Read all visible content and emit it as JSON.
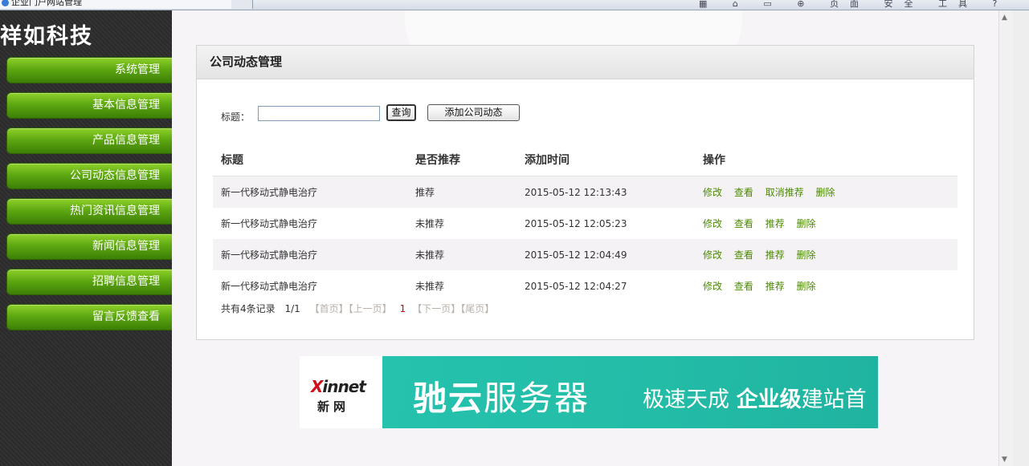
{
  "browser": {
    "tab_title": "企业门户网站管理",
    "toolbar_glyphs": "▦ ⌂ ▭ ⊕ 页面 安全 工具 ?"
  },
  "sidebar": {
    "brand": "祥如科技",
    "items": [
      {
        "label": "系统管理"
      },
      {
        "label": "基本信息管理"
      },
      {
        "label": "产品信息管理"
      },
      {
        "label": "公司动态信息管理"
      },
      {
        "label": "热门资讯信息管理"
      },
      {
        "label": "新闻信息管理"
      },
      {
        "label": "招聘信息管理"
      },
      {
        "label": "留言反馈查看"
      }
    ]
  },
  "panel": {
    "title": "公司动态管理",
    "search": {
      "label": "标题：",
      "value": "",
      "query_button": "查询",
      "add_button": "添加公司动态"
    },
    "columns": [
      "标题",
      "是否推荐",
      "添加时间",
      "操作"
    ],
    "rows": [
      {
        "title": "新一代移动式静电治疗",
        "recommend": "推荐",
        "time": "2015-05-12 12:13:43",
        "ops": [
          "修改",
          "查看",
          "取消推荐",
          "删除"
        ]
      },
      {
        "title": "新一代移动式静电治疗",
        "recommend": "未推荐",
        "time": "2015-05-12 12:05:23",
        "ops": [
          "修改",
          "查看",
          "推荐",
          "删除"
        ]
      },
      {
        "title": "新一代移动式静电治疗",
        "recommend": "未推荐",
        "time": "2015-05-12 12:04:49",
        "ops": [
          "修改",
          "查看",
          "推荐",
          "删除"
        ]
      },
      {
        "title": "新一代移动式静电治疗",
        "recommend": "未推荐",
        "time": "2015-05-12 12:04:27",
        "ops": [
          "修改",
          "查看",
          "推荐",
          "删除"
        ]
      }
    ],
    "pager": {
      "total": "共有4条记录",
      "pages": "1/1",
      "first": "【首页】",
      "prev": "【上一页】",
      "current": "1",
      "next": "【下一页】",
      "last": "【尾页】"
    }
  },
  "ad": {
    "logo_x": "X",
    "logo_rest": "innet",
    "logo_cn": "新网",
    "headline_a": "驰云",
    "headline_b": "服务器",
    "tagline_a": "极速天成 ",
    "tagline_b": "企业级",
    "tagline_c": "建站首"
  }
}
